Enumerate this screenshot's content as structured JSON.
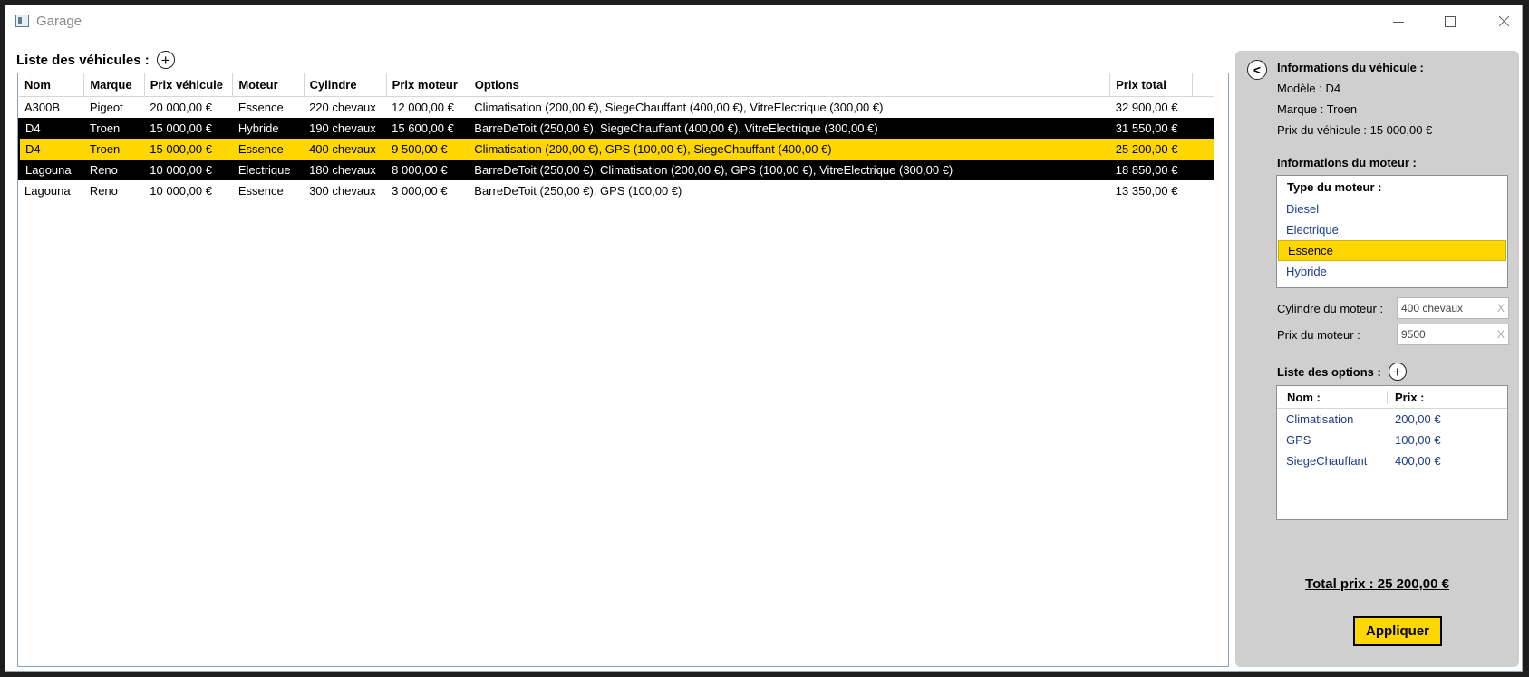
{
  "window": {
    "title": "Garage"
  },
  "vehicle_list": {
    "heading": "Liste des véhicules :",
    "columns": [
      "Nom",
      "Marque",
      "Prix véhicule",
      "Moteur",
      "Cylindre",
      "Prix moteur",
      "Options",
      "Prix total"
    ],
    "rows": [
      {
        "nom": "A300B",
        "marque": "Pigeot",
        "prix_vehicule": "20 000,00 €",
        "moteur": "Essence",
        "cylindre": "220 chevaux",
        "prix_moteur": "12 000,00 €",
        "options": "Climatisation (200,00 €), SiegeChauffant (400,00 €), VitreElectrique (300,00 €)",
        "prix_total": "32 900,00 €",
        "style": "normal"
      },
      {
        "nom": "D4",
        "marque": "Troen",
        "prix_vehicule": "15 000,00 €",
        "moteur": "Hybride",
        "cylindre": "190 chevaux",
        "prix_moteur": "15 600,00 €",
        "options": "BarreDeToit (250,00 €), SiegeChauffant (400,00 €), VitreElectrique (300,00 €)",
        "prix_total": "31 550,00 €",
        "style": "dark"
      },
      {
        "nom": "D4",
        "marque": "Troen",
        "prix_vehicule": "15 000,00 €",
        "moteur": "Essence",
        "cylindre": "400 chevaux",
        "prix_moteur": "9 500,00 €",
        "options": "Climatisation (200,00 €), GPS (100,00 €), SiegeChauffant (400,00 €)",
        "prix_total": "25 200,00 €",
        "style": "yellow"
      },
      {
        "nom": "Lagouna",
        "marque": "Reno",
        "prix_vehicule": "10 000,00 €",
        "moteur": "Electrique",
        "cylindre": "180 chevaux",
        "prix_moteur": "8 000,00 €",
        "options": "BarreDeToit (250,00 €), Climatisation (200,00 €), GPS (100,00 €), VitreElectrique (300,00 €)",
        "prix_total": "18 850,00 €",
        "style": "dark"
      },
      {
        "nom": "Lagouna",
        "marque": "Reno",
        "prix_vehicule": "10 000,00 €",
        "moteur": "Essence",
        "cylindre": "300 chevaux",
        "prix_moteur": "3 000,00 €",
        "options": "BarreDeToit (250,00 €), GPS (100,00 €)",
        "prix_total": "13 350,00 €",
        "style": "normal"
      }
    ]
  },
  "details": {
    "vehicle_title": "Informations du véhicule :",
    "modele": "Modèle : D4",
    "marque": "Marque : Troen",
    "prix": "Prix du véhicule : 15 000,00 €",
    "engine_title": "Informations du moteur :",
    "engine_type_header": "Type du moteur :",
    "engine_types": [
      "Diesel",
      "Electrique",
      "Essence",
      "Hybride"
    ],
    "engine_selected": "Essence",
    "cylindre_label": "Cylindre du moteur :",
    "cylindre_value": "400 chevaux",
    "prix_moteur_label": "Prix du moteur :",
    "prix_moteur_value": "9500",
    "clear_glyph": "X",
    "options_title": "Liste des options :",
    "options_headers": [
      "Nom :",
      "Prix :"
    ],
    "options": [
      {
        "nom": "Climatisation",
        "prix": "200,00 €"
      },
      {
        "nom": "GPS",
        "prix": "100,00 €"
      },
      {
        "nom": "SiegeChauffant",
        "prix": "400,00 €"
      }
    ],
    "total": "Total prix : 25 200,00 €",
    "apply_label": "Appliquer"
  },
  "colors": {
    "highlight": "#ffd700",
    "selected_dark": "#000000",
    "panel": "#cfcfcf",
    "list_item": "#1d3d8a"
  },
  "icons": [
    "app-icon",
    "minimize-icon",
    "maximize-icon",
    "close-icon",
    "add-icon",
    "back-arrow-icon"
  ]
}
